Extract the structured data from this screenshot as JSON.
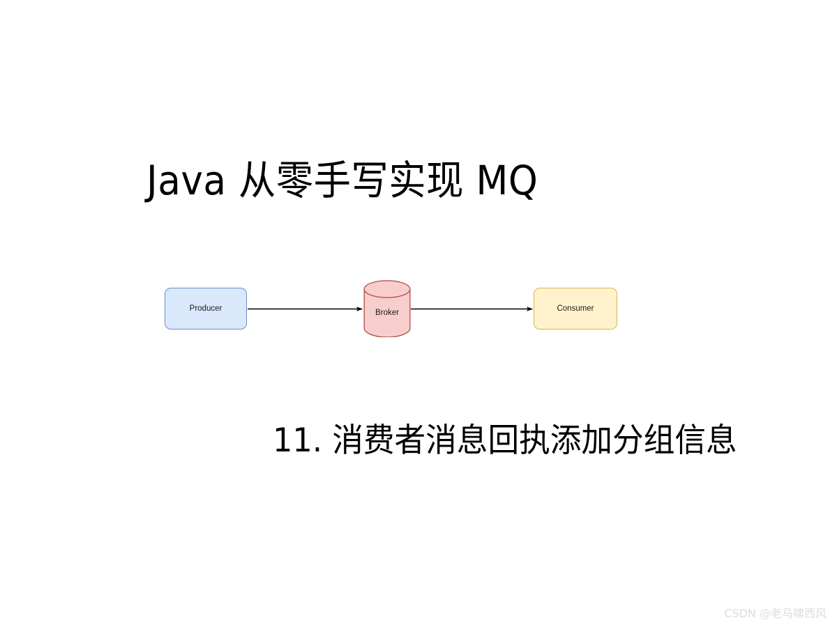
{
  "slide": {
    "background_color": "#ffffff",
    "title": "Java 从零手写实现 MQ",
    "subtitle": "11. 消费者消息回执添加分组信息"
  },
  "diagram": {
    "type": "flow",
    "nodes": [
      {
        "id": "producer",
        "label": "Producer",
        "shape": "rounded-rectangle",
        "fill": "#dae8fc",
        "stroke": "#6c8ebf"
      },
      {
        "id": "broker",
        "label": "Broker",
        "shape": "cylinder",
        "fill": "#f8cecc",
        "stroke": "#b85450"
      },
      {
        "id": "consumer",
        "label": "Consumer",
        "shape": "rounded-rectangle",
        "fill": "#fff2cc",
        "stroke": "#d6b656"
      }
    ],
    "edges": [
      {
        "id": "producer-to-broker",
        "from": "producer",
        "to": "broker",
        "color": "#000000"
      },
      {
        "id": "broker-to-consumer",
        "from": "broker",
        "to": "consumer",
        "color": "#000000"
      }
    ]
  },
  "watermark": {
    "text": "CSDN @老马啸西风",
    "color": "#dcdcdc"
  }
}
